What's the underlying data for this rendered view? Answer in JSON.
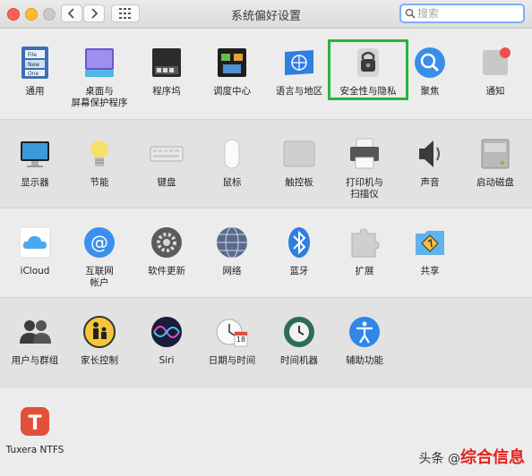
{
  "window": {
    "title": "系统偏好设置"
  },
  "search": {
    "placeholder": "搜索"
  },
  "sections": [
    [
      {
        "label": "通用",
        "icon": "general-icon"
      },
      {
        "label": "桌面与\n屏幕保护程序",
        "icon": "desktop-icon"
      },
      {
        "label": "程序坞",
        "icon": "dock-icon"
      },
      {
        "label": "调度中心",
        "icon": "mission-control-icon"
      },
      {
        "label": "语言与地区",
        "icon": "language-region-icon"
      },
      {
        "label": "安全性与隐私",
        "icon": "security-privacy-icon"
      },
      {
        "label": "聚焦",
        "icon": "spotlight-icon"
      },
      {
        "label": "通知",
        "icon": "notifications-icon"
      }
    ],
    [
      {
        "label": "显示器",
        "icon": "displays-icon"
      },
      {
        "label": "节能",
        "icon": "energy-saver-icon"
      },
      {
        "label": "键盘",
        "icon": "keyboard-icon"
      },
      {
        "label": "鼠标",
        "icon": "mouse-icon"
      },
      {
        "label": "触控板",
        "icon": "trackpad-icon"
      },
      {
        "label": "打印机与\n扫描仪",
        "icon": "printer-icon"
      },
      {
        "label": "声音",
        "icon": "sound-icon"
      },
      {
        "label": "启动磁盘",
        "icon": "startup-disk-icon"
      }
    ],
    [
      {
        "label": "iCloud",
        "icon": "icloud-icon"
      },
      {
        "label": "互联网\n帐户",
        "icon": "internet-accounts-icon"
      },
      {
        "label": "软件更新",
        "icon": "software-update-icon"
      },
      {
        "label": "网络",
        "icon": "network-icon"
      },
      {
        "label": "蓝牙",
        "icon": "bluetooth-icon"
      },
      {
        "label": "扩展",
        "icon": "extensions-icon"
      },
      {
        "label": "共享",
        "icon": "sharing-icon"
      }
    ],
    [
      {
        "label": "用户与群组",
        "icon": "users-groups-icon"
      },
      {
        "label": "家长控制",
        "icon": "parental-controls-icon"
      },
      {
        "label": "Siri",
        "icon": "siri-icon"
      },
      {
        "label": "日期与时间",
        "icon": "date-time-icon"
      },
      {
        "label": "时间机器",
        "icon": "time-machine-icon"
      },
      {
        "label": "辅助功能",
        "icon": "accessibility-icon"
      }
    ],
    [
      {
        "label": "Tuxera NTFS",
        "icon": "tuxera-ntfs-icon"
      }
    ]
  ],
  "date_icon_day": "18",
  "notification_badge_color": "#f04e4e",
  "highlight_color": "#26b43a",
  "watermark": {
    "prefix": "头条 @",
    "name": "综合信息"
  }
}
